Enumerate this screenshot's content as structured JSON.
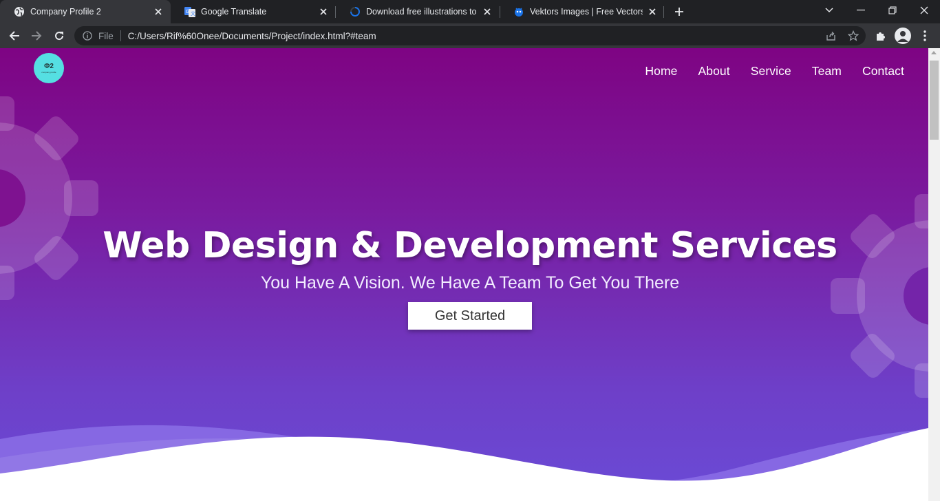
{
  "browser": {
    "tabs": [
      {
        "title": "Company Profile 2",
        "icon": "globe-icon",
        "active": true
      },
      {
        "title": "Google Translate",
        "icon": "google-translate-icon",
        "active": false
      },
      {
        "title": "Download free illustrations to po",
        "icon": "loading-spinner-icon",
        "active": false
      },
      {
        "title": "Vektors Images | Free Vectors, Sto",
        "icon": "vektors-icon",
        "active": false
      }
    ],
    "address": {
      "scheme": "File",
      "url": "C:/Users/Rif%60Onee/Documents/Project/index.html?#team"
    }
  },
  "site": {
    "logo": {
      "mark": "Φ2",
      "subtitle": "company profile"
    },
    "nav": [
      "Home",
      "About",
      "Service",
      "Team",
      "Contact"
    ],
    "hero": {
      "title": "Web Design & Development Services",
      "subtitle": "You Have A Vision. We Have A Team To Get You There",
      "cta": "Get Started"
    }
  },
  "colors": {
    "gradient_top": "#7e0483",
    "gradient_bottom": "#6a4bd6",
    "logo_bg": "#55dfe2",
    "wave": "#8b6fe6"
  }
}
